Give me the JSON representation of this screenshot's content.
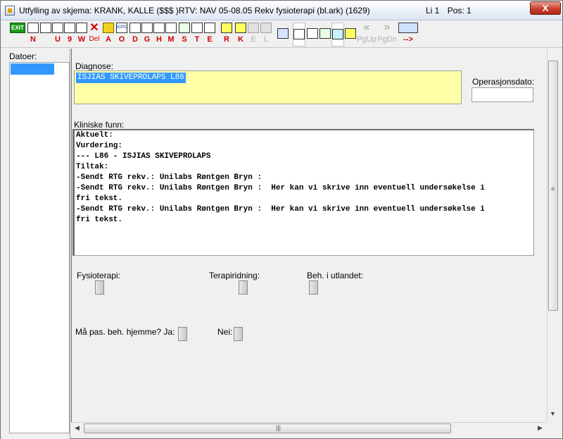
{
  "window": {
    "title": "Utfylling av skjema: KRANK, KALLE ($$$ )RTV: NAV 05-08.05 Rekv fysioterapi (bl.ark) (1629)",
    "line": "Li 1",
    "pos": "Pos: 1",
    "close_label": "X"
  },
  "toolbar": {
    "buttons": [
      {
        "icon": "exit-icon",
        "glyph": "EXIT",
        "key": ""
      },
      {
        "icon": "new-document-icon",
        "glyph": "",
        "key": "N"
      },
      {
        "icon": "print-icon",
        "glyph": "",
        "key": ""
      },
      {
        "icon": "printer-icon",
        "glyph": "",
        "key": "U"
      },
      {
        "icon": "printer-preview-icon",
        "glyph": "",
        "key": "9"
      },
      {
        "icon": "document-edit-icon",
        "glyph": "",
        "key": "W"
      },
      {
        "icon": "delete-icon",
        "glyph": "✕",
        "key": "Del"
      },
      {
        "icon": "envelope-icon",
        "glyph": "",
        "key": "A"
      },
      {
        "icon": "icpc-icon",
        "glyph": "ICPC",
        "key": "O"
      },
      {
        "icon": "calculator-icon",
        "glyph": "",
        "key": "D"
      },
      {
        "icon": "copy-icon",
        "glyph": "",
        "key": "G"
      },
      {
        "icon": "insert-icon",
        "glyph": "",
        "key": "H"
      },
      {
        "icon": "check-list-icon",
        "glyph": "",
        "key": "M"
      },
      {
        "icon": "test-tube-icon",
        "glyph": "",
        "key": "S"
      },
      {
        "icon": "edit-pencil-icon",
        "glyph": "",
        "key": "T"
      },
      {
        "icon": "form-icon",
        "glyph": "",
        "key": "E"
      },
      {
        "icon": "folder-r-icon",
        "glyph": "",
        "key": "R"
      },
      {
        "icon": "folder-k-icon",
        "glyph": "",
        "key": "K"
      },
      {
        "icon": "folder-e-icon",
        "glyph": "",
        "key": "E"
      },
      {
        "icon": "folder-l-icon",
        "glyph": "",
        "key": "L"
      }
    ],
    "right_buttons": [
      {
        "icon": "window-icon",
        "glyph": ""
      },
      {
        "icon": "table-icon",
        "glyph": ""
      },
      {
        "icon": "table-print-icon",
        "glyph": ""
      },
      {
        "icon": "walk-icon",
        "glyph": ""
      },
      {
        "icon": "walk-cyan-icon",
        "glyph": ""
      },
      {
        "icon": "transfer-icon",
        "glyph": ""
      }
    ],
    "nav": [
      {
        "icon": "page-up-icon",
        "glyph": "«",
        "key": "PgUp"
      },
      {
        "icon": "page-down-icon",
        "glyph": "»",
        "key": "PgDn"
      }
    ],
    "last": {
      "icon": "columns-icon",
      "glyph": "",
      "key": "-->"
    }
  },
  "left_pane": {
    "label": "Datoer:"
  },
  "form": {
    "diagnosis_label": "Diagnose:",
    "diagnosis_value": "ISJIAS SKIVEPROLAPS L86",
    "opdate_label": "Operasjonsdato:",
    "findings_label": "Kliniske funn:",
    "findings_lines": [
      "Aktuelt:",
      "Vurdering:",
      "--- L86 - ISJIAS SKIVEPROLAPS",
      "Tiltak:",
      "-Sendt RTG rekv.: Unilabs Røntgen Bryn :",
      "-Sendt RTG rekv.: Unilabs Røntgen Bryn :  Her kan vi skrive inn eventuell undersøkelse i",
      "fri tekst.",
      "-Sendt RTG rekv.: Unilabs Røntgen Bryn :  Her kan vi skrive inn eventuell undersøkelse i",
      "fri tekst."
    ],
    "physio_label": "Fysioterapi:",
    "riding_label": "Terapiridning:",
    "abroad_label": "Beh. i utlandet:",
    "home_label": "Må pas. beh. hjemme? Ja:",
    "no_label": "Nei:"
  },
  "colors": {
    "diagnosis_bg": "#ffffa8",
    "selection": "#3399ff",
    "key_red": "#d00000"
  }
}
